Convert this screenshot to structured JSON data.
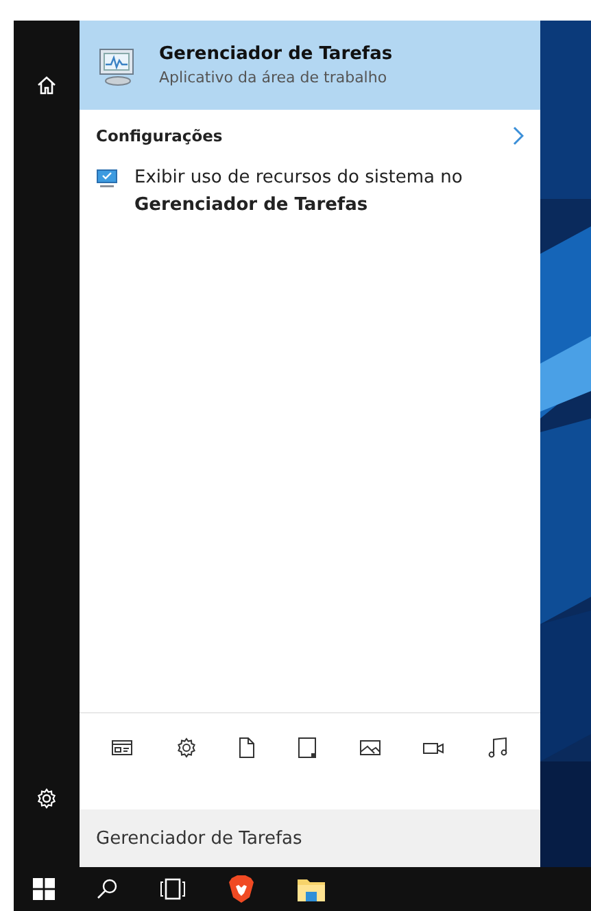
{
  "top_result": {
    "title": "Gerenciador de Tarefas",
    "subtitle": "Aplicativo da área de trabalho",
    "selected": true
  },
  "section": {
    "heading": "Configurações",
    "items": [
      {
        "text": "Exibir uso de recursos do sistema no **Gerenciador de Tarefas**"
      }
    ]
  },
  "search": {
    "value": "Gerenciador de Tarefas"
  }
}
